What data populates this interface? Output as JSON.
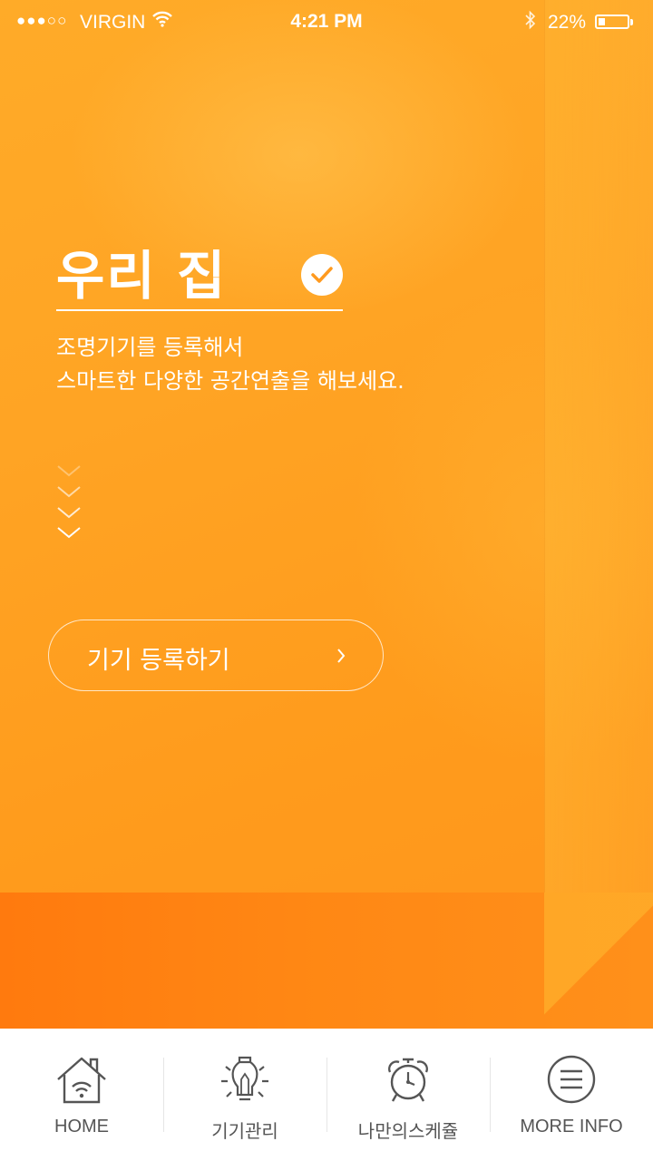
{
  "status_bar": {
    "signal": "●●●○○",
    "carrier": "VIRGIN",
    "time": "4:21 PM",
    "battery_text": "22%",
    "battery_level": 0.22
  },
  "main": {
    "title": "우리 집",
    "subtitle_line1": "조명기기를 등록해서",
    "subtitle_line2": "스마트한 다양한 공간연출을 해보세요.",
    "cta_label": "기기 등록하기"
  },
  "tabbar": {
    "items": [
      {
        "label": "HOME",
        "icon": "home-wifi-icon"
      },
      {
        "label": "기기관리",
        "icon": "light-bulb-icon"
      },
      {
        "label": "나만의스케쥴",
        "icon": "alarm-clock-icon"
      },
      {
        "label": "MORE INFO",
        "icon": "menu-icon"
      }
    ]
  },
  "colors": {
    "accent": "#ff9a1f",
    "floor": "#ff7a0e",
    "tab_icon": "#555555"
  }
}
